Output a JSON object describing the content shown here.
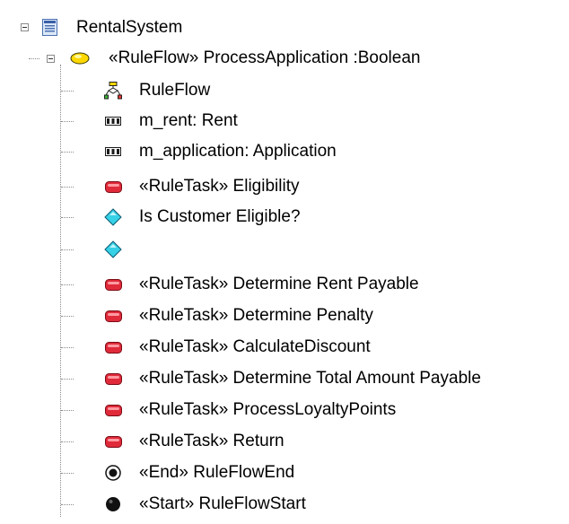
{
  "tree": {
    "root": {
      "label": "RentalSystem",
      "icon": "package-icon",
      "expanded": true
    },
    "ruleflow": {
      "label": "«RuleFlow» ProcessApplication :Boolean",
      "icon": "ruleflow-operation-icon",
      "expanded": true
    },
    "children": [
      {
        "label": "RuleFlow",
        "icon": "activity-diagram-icon"
      },
      {
        "label": "m_rent: Rent",
        "icon": "attribute-icon"
      },
      {
        "label": "m_application: Application",
        "icon": "attribute-icon"
      },
      {
        "label": "«RuleTask» Eligibility",
        "icon": "rule-task-icon"
      },
      {
        "label": "Is Customer Eligible?",
        "icon": "decision-icon"
      },
      {
        "label": "",
        "icon": "decision-icon"
      },
      {
        "label": "«RuleTask» Determine Rent Payable",
        "icon": "rule-task-icon"
      },
      {
        "label": "«RuleTask» Determine Penalty",
        "icon": "rule-task-icon"
      },
      {
        "label": "«RuleTask» CalculateDiscount",
        "icon": "rule-task-icon"
      },
      {
        "label": "«RuleTask» Determine Total Amount Payable",
        "icon": "rule-task-icon"
      },
      {
        "label": "«RuleTask» ProcessLoyaltyPoints",
        "icon": "rule-task-icon"
      },
      {
        "label": "«RuleTask» Return",
        "icon": "rule-task-icon"
      },
      {
        "label": "«End» RuleFlowEnd",
        "icon": "final-node-icon"
      },
      {
        "label": "«Start» RuleFlowStart",
        "icon": "initial-node-icon"
      }
    ]
  }
}
